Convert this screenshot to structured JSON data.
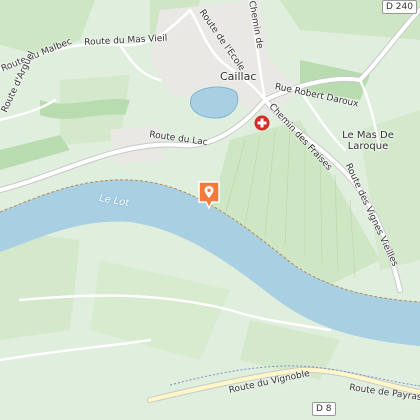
{
  "map": {
    "colors": {
      "vineyard": "#dfeedd",
      "field": "#cfe6c4",
      "forest": "#b9dbb0",
      "river": "#a9cfe3",
      "road_major": "#ffffff",
      "road_route": "#fff7c8",
      "urban": "#e9e8e4",
      "pin": "#f07b3a",
      "pharmacy": "#d42a2a"
    },
    "labels": {
      "town": "Caillac",
      "place": "Le Mas De Laroque",
      "river": "Le Lot",
      "road_route_malbec": "Route du Malbec",
      "road_mas_vieil": "Route du Mas Vieil",
      "road_ecole": "Route de l'Ecole",
      "road_chemin_de": "Chemin de",
      "road_robert_daroux": "Rue Robert Daroux",
      "road_chemin_fraises": "Chemin des Fraises",
      "road_lac": "Route du Lac",
      "road_vignes_vieilles": "Route des Vignes Vieilles",
      "road_vignoble": "Route du Vignoble",
      "road_payras": "Route de Payras",
      "road_arguel": "Route d'Arguel",
      "shield_d240": "D 240",
      "shield_d8": "D 8"
    },
    "icons": {
      "location_pin": "map-pin-icon",
      "pharmacy": "pharmacy-cross-icon"
    }
  }
}
